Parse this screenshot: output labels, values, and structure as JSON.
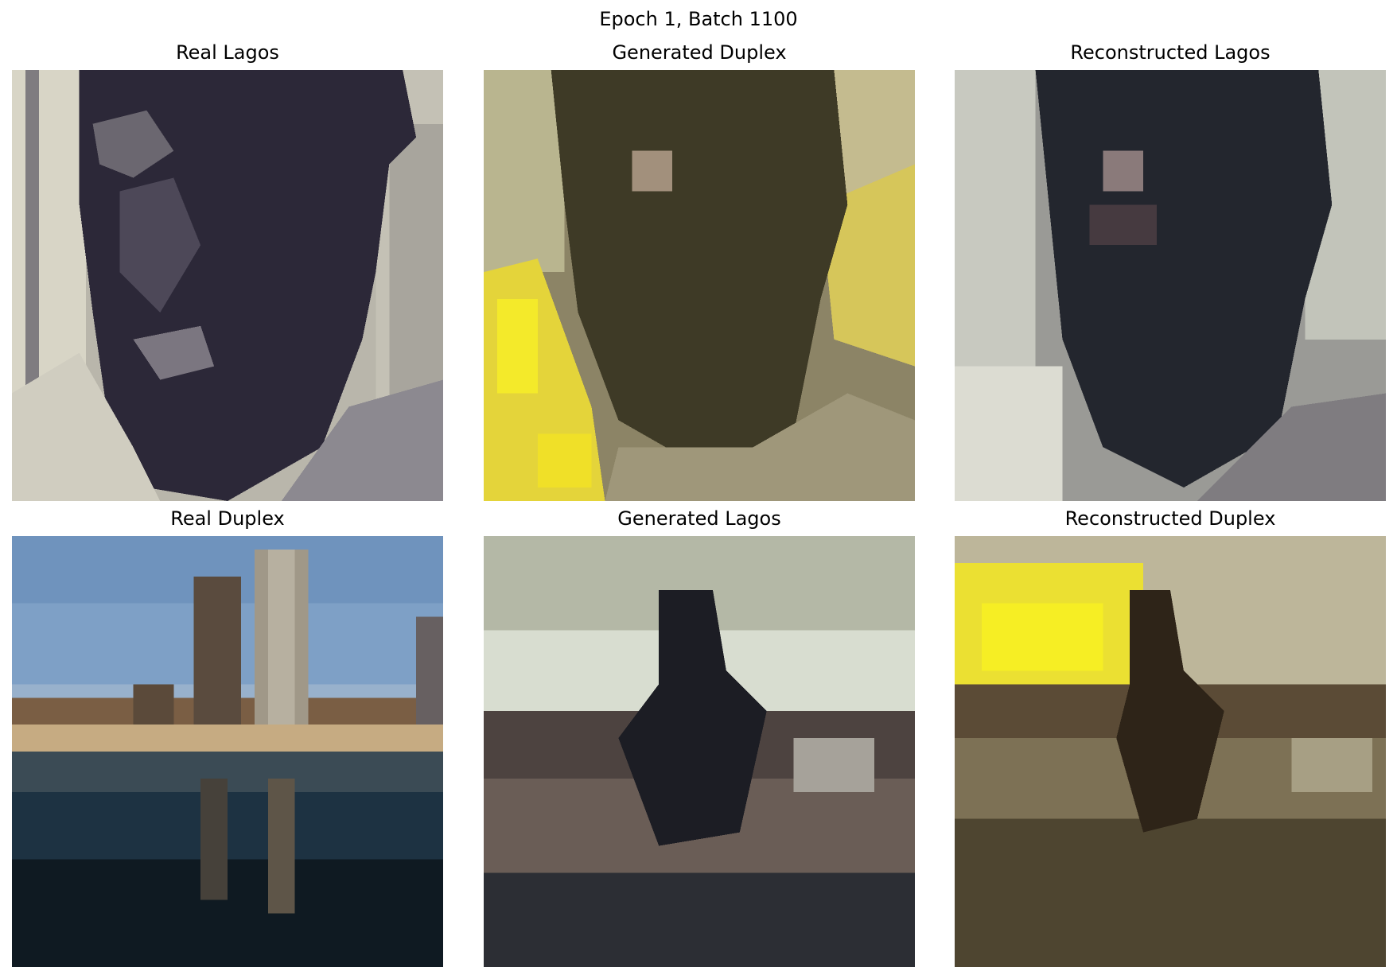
{
  "figure": {
    "title": "Epoch 1, Batch 1100"
  },
  "panels": [
    {
      "title": "Real Lagos"
    },
    {
      "title": "Generated Duplex"
    },
    {
      "title": "Reconstructed Lagos"
    },
    {
      "title": "Real Duplex"
    },
    {
      "title": "Generated Lagos"
    },
    {
      "title": "Reconstructed Duplex"
    }
  ]
}
